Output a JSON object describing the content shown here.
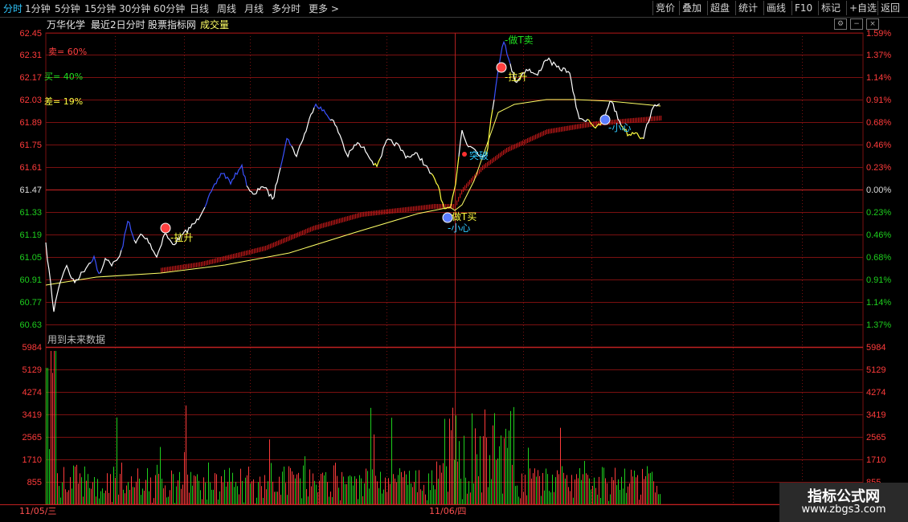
{
  "timeframes": [
    "分时",
    "1分钟",
    "5分钟",
    "15分钟",
    "30分钟",
    "60分钟",
    "日线",
    "周线",
    "月线",
    "多分时",
    "更多 >"
  ],
  "active_timeframe": "分时",
  "right_buttons": [
    "竞价",
    "叠加",
    "超盘",
    "统计",
    "画线",
    "F10",
    "标记",
    "+自选",
    "返回"
  ],
  "info": {
    "stock_name": "万华化学",
    "period": "最近2日分时",
    "indicator": "股票指标网",
    "volume_label": "成交量"
  },
  "price_axis": [
    "62.45",
    "62.31",
    "62.17",
    "62.03",
    "61.89",
    "61.75",
    "61.61",
    "61.47",
    "61.33",
    "61.19",
    "61.05",
    "60.91",
    "60.77",
    "60.63"
  ],
  "pct_axis": [
    "1.59%",
    "1.37%",
    "1.14%",
    "0.91%",
    "0.68%",
    "0.46%",
    "0.23%",
    "0.00%",
    "0.23%",
    "0.46%",
    "0.68%",
    "0.91%",
    "1.14%",
    "1.37%"
  ],
  "volume_axis": [
    "5984",
    "5129",
    "4274",
    "3419",
    "2565",
    "1710",
    "855"
  ],
  "indicators": {
    "sell": "卖= 60%",
    "buy": "买= 40%",
    "diff": "差= 19%"
  },
  "future_data_note": "用到未来数据",
  "dates": [
    "11/05/三",
    "11/06/四"
  ],
  "annotations": {
    "lift_up": "拉升",
    "do_t_sell": "做T卖",
    "do_t_buy": "做T买",
    "careful": "小心",
    "breakout": "突破"
  },
  "watermark": {
    "title": "指标公式网",
    "url": "www.zbgs3.com"
  },
  "colors": {
    "up": "#ff3b3b",
    "down": "#1ecf1e",
    "price_line": "#ffffff",
    "avg_line": "#ffff66",
    "accent": "#30c8ff",
    "grid": "#7a1010"
  },
  "chart_data": {
    "type": "line",
    "prev_close": 61.47,
    "price_range": [
      60.63,
      62.45
    ],
    "volume_range": [
      0,
      5984
    ]
  }
}
